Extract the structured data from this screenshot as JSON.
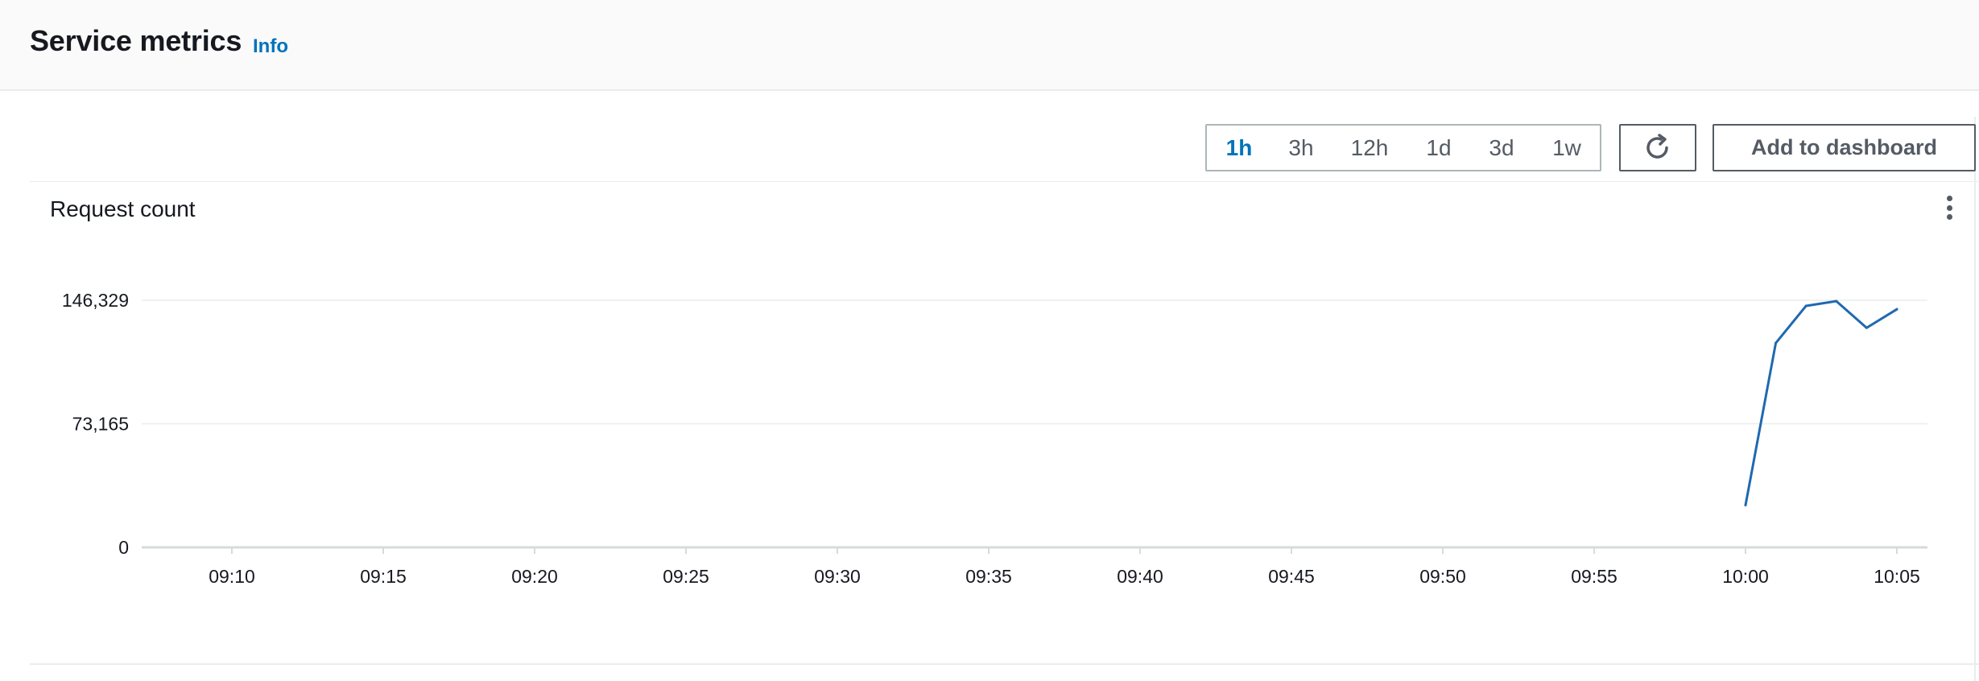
{
  "header": {
    "title": "Service metrics",
    "info_link": "Info"
  },
  "toolbar": {
    "time_ranges": [
      "1h",
      "3h",
      "12h",
      "1d",
      "3d",
      "1w"
    ],
    "selected_range": "1h",
    "refresh_icon": "refresh-icon",
    "add_to_dashboard_label": "Add to dashboard"
  },
  "widget": {
    "menu_icon": "more-vertical-icon"
  },
  "colors": {
    "accent": "#0073bb",
    "series": "#1f69b0",
    "grid": "#eaeded",
    "axis": "#d5dbdb"
  },
  "chart_data": {
    "type": "line",
    "title": "Request count",
    "xlabel": "",
    "ylabel": "",
    "x_ticks": [
      "09:10",
      "09:15",
      "09:20",
      "09:25",
      "09:30",
      "09:35",
      "09:40",
      "09:45",
      "09:50",
      "09:55",
      "10:00",
      "10:05"
    ],
    "y_ticks": [
      0,
      73165,
      146329
    ],
    "y_tick_labels": [
      "0",
      "73,165",
      "146,329"
    ],
    "ylim": [
      0,
      146329
    ],
    "grid": "horizontal",
    "series": [
      {
        "x": [
          "10:00",
          "10:01",
          "10:02",
          "10:03",
          "10:04",
          "10:05"
        ],
        "values": [
          25000,
          121000,
          143000,
          145800,
          130000,
          141000
        ]
      }
    ]
  }
}
